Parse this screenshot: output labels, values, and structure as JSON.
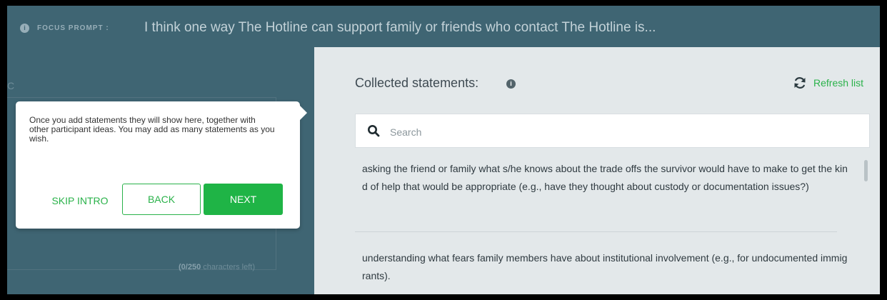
{
  "focus_prompt": {
    "label": "FOCUS PROMPT :",
    "text": "I think one way The Hotline can support family or friends who contact The Hotline is..."
  },
  "left": {
    "ghost_letter": "C",
    "char_count_number": "(0/250",
    "char_count_suffix": " characters left)"
  },
  "tooltip": {
    "text": "Once you add statements they will show here, together with other participant ideas. You may add as many statements as you wish.",
    "skip_label": "SKIP INTRO",
    "back_label": "BACK",
    "next_label": "NEXT"
  },
  "panel": {
    "title": "Collected statements:",
    "info_glyph": "i",
    "refresh_label": "Refresh list",
    "search_placeholder": "Search",
    "statements": [
      "asking the friend or family what s/he knows about the trade offs the survivor would have to make to get the kind of help that would be appropriate (e.g., have they thought about custody or documentation issues?)",
      "understanding what fears family members have about institutional involvement (e.g., for undocumented immigrants)."
    ]
  },
  "colors": {
    "accent_green": "#2ab24a",
    "overlay_teal": "#3f6573",
    "panel_bg": "#e3e8ea"
  },
  "icons": [
    "info-icon",
    "refresh-icon",
    "search-icon"
  ]
}
